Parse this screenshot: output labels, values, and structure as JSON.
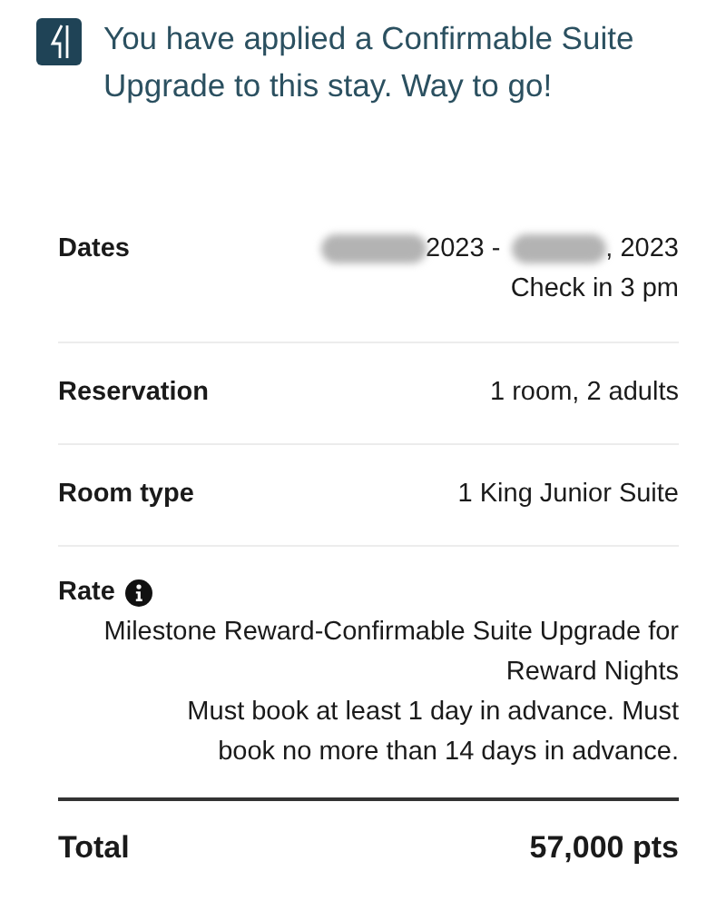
{
  "banner": {
    "message": "You have applied a Confirmable Suite Upgrade to this stay. Way to go!"
  },
  "details": [
    {
      "kind": "dates",
      "label": "Dates",
      "start_visible": "2023 -",
      "end_visible": ", 2023",
      "note": "Check in 3 pm"
    },
    {
      "kind": "simple",
      "label": "Reservation",
      "value": "1 room, 2 adults"
    },
    {
      "kind": "simple",
      "label": "Room type",
      "value": "1 King Junior Suite"
    }
  ],
  "rate": {
    "label": "Rate",
    "name": "Milestone Reward-Confirmable Suite Upgrade for Reward Nights",
    "terms": "Must book at least 1 day in advance. Must book no more than 14 days in advance."
  },
  "total": {
    "label": "Total",
    "value": "57,000 pts"
  }
}
